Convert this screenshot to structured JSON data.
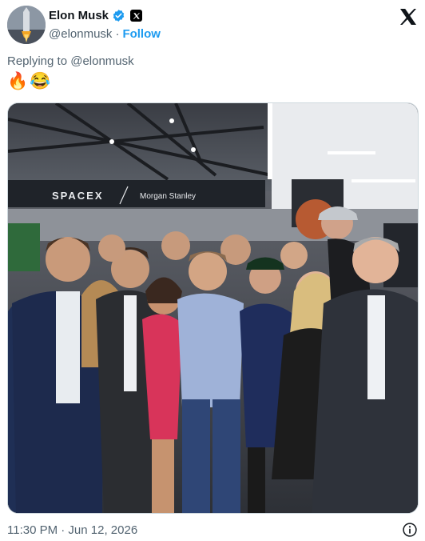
{
  "tweet": {
    "display_name": "Elon Musk",
    "handle": "@elonmusk",
    "separator": "·",
    "follow_label": "Follow",
    "reply_context": "Replying to @elonmusk",
    "emojis": [
      "🔥",
      "😂"
    ],
    "timestamp": "11:30 PM · Jun 12, 2026"
  },
  "photo": {
    "banner_left": "SPACEX",
    "banner_right": "Morgan Stanley"
  },
  "icons": {
    "verified": "verified-badge-icon",
    "x_affiliation": "x-affiliation-icon",
    "x_logo": "x-logo-icon",
    "info": "info-icon"
  },
  "colors": {
    "accent": "#1d9bf0",
    "secondary_text": "#536471",
    "primary_text": "#0f1419"
  }
}
